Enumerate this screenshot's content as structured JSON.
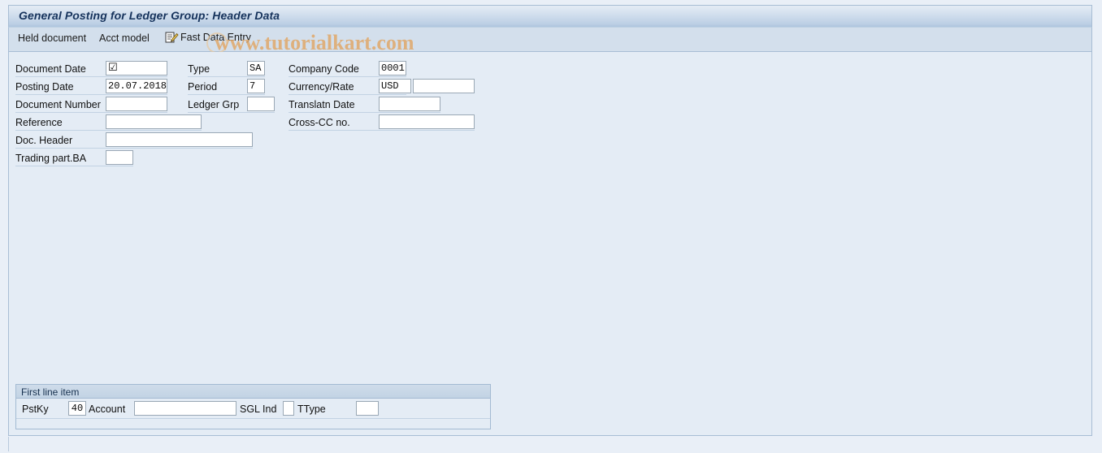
{
  "window": {
    "title": "General Posting for Ledger Group: Header Data"
  },
  "toolbar": {
    "held_document": "Held document",
    "acct_model": "Acct model",
    "fast_data_entry": "Fast Data Entry",
    "fast_data_entry_icon": "note-pencil-icon"
  },
  "watermark": {
    "text": "www.tutorialkart.com",
    "color": "#e0a86a"
  },
  "header_data": {
    "rows": [
      {
        "label": "Document Date",
        "value": "☑",
        "label2": "Type",
        "value2": "SA",
        "label3": "Company Code",
        "value3": "0001"
      },
      {
        "label": "Posting Date",
        "value": "20.07.2018",
        "label2": "Period",
        "value2": "7",
        "label3": "Currency/Rate",
        "value3": "USD",
        "value3b": ""
      },
      {
        "label": "Document Number",
        "value": "",
        "label2": "Ledger Grp",
        "value2": "",
        "label3": "Translatn Date",
        "value3": ""
      },
      {
        "label": "Reference",
        "value": "",
        "label3": "Cross-CC no.",
        "value3": ""
      },
      {
        "label": "Doc. Header",
        "value": ""
      },
      {
        "label": "Trading part.BA",
        "value": ""
      }
    ]
  },
  "first_line_item": {
    "title": "First line item",
    "pstky_label": "PstKy",
    "pstky_value": "40",
    "account_label": "Account",
    "account_value": "",
    "sgl_ind_label": "SGL Ind",
    "sgl_ind_value": "",
    "ttype_label": "TType",
    "ttype_value": ""
  },
  "colors": {
    "window_bg": "#e9eff7",
    "panel_bg": "#e4ecf5",
    "title_accent": "#aec5de",
    "toolbar_bg": "#d3dfec",
    "border": "#a8bdd4",
    "text": "#111111"
  }
}
